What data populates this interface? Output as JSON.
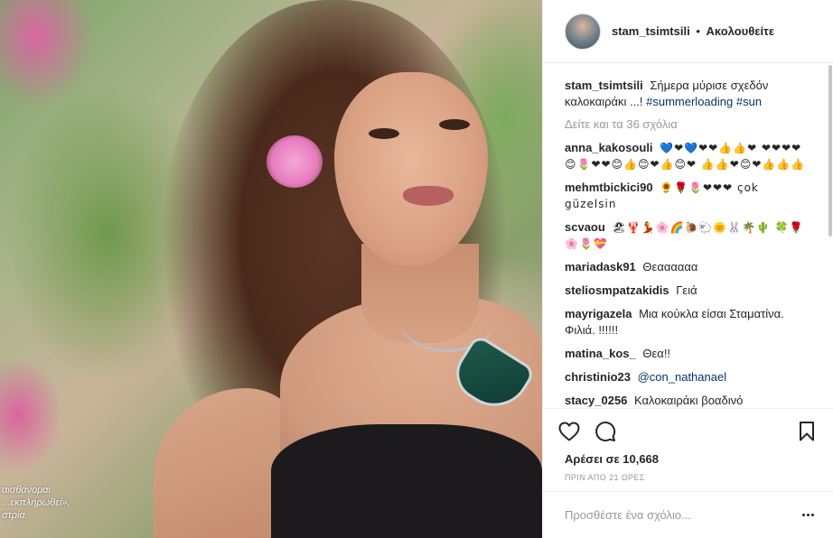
{
  "post": {
    "username": "stam_tsimtsili",
    "separator": "•",
    "follow_label": "Ακολουθείτε",
    "magazine_overlay": "αισθάνομαι\n...εκπληρωθεί»,\nστρία."
  },
  "caption": {
    "username": "stam_tsimtsili",
    "text": "Σήμερα μύρισε σχεδόν καλοκαιράκι ...!",
    "tags": [
      "#summerloading",
      "#sun"
    ]
  },
  "load_more_label": "Δείτε και τα 36 σχόλια",
  "comments": [
    {
      "username": "anna_kakosouli",
      "text": "💙❤💙❤❤👍👍❤ ❤❤❤❤😊🌷❤❤😊👍😊❤👍😊❤ 👍👍❤😊❤👍👍👍"
    },
    {
      "username": "mehmtbickici90",
      "text": "🌻🌹🌷❤❤❤ çok güzelsin"
    },
    {
      "username": "scvaou",
      "text": "🏖🦞💃🌸🌈🐌🐑🌞🐰🌴🌵 🍀🌹🌸🌷💝"
    },
    {
      "username": "mariadask91",
      "text": "Θεαααααα"
    },
    {
      "username": "steliosmpatzakidis",
      "text": "Γειά"
    },
    {
      "username": "mayrigazela",
      "text": "Μια κούκλα είσαι Σταματίνα. Φιλιά. !!!!!!"
    },
    {
      "username": "matina_kos_",
      "text": "Θεα!!"
    },
    {
      "username": "christinio23",
      "mention": "@con_nathanael"
    },
    {
      "username": "stacy_0256",
      "text": "Καλοκαιράκι βοαδινό"
    }
  ],
  "actions": {
    "like_icon": "heart-outline-icon",
    "comment_icon": "speech-bubble-icon",
    "save_icon": "bookmark-icon",
    "likes_text": "Αρέσει σε 10,668",
    "time_text": "ΠΡΙΝ ΑΠΟ 21 ΩΡΕΣ"
  },
  "add_comment": {
    "placeholder": "Προσθέστε ένα σχόλιο..."
  },
  "colors": {
    "link": "#003569",
    "muted": "#999999",
    "border": "#efefef",
    "text": "#262626"
  }
}
